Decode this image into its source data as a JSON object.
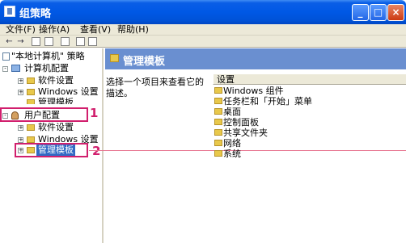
{
  "window": {
    "title": "组策略",
    "buttons": {
      "minimize": "_",
      "maximize": "□",
      "close": "×"
    }
  },
  "menu": [
    "文件(F)",
    "操作(A)",
    "查看(V)",
    "帮助(H)"
  ],
  "tree": {
    "root": "\"本地计算机\" 策略",
    "computer": "计算机配置",
    "c_software": "软件设置",
    "c_windows": "Windows 设置",
    "c_admin": "管理模板",
    "user": "用户配置",
    "u_software": "软件设置",
    "u_windows": "Windows 设置",
    "u_admin": "管理模板"
  },
  "annotations": {
    "one": "1",
    "two": "2"
  },
  "panel": {
    "title": "管理模板",
    "description": "选择一个项目来查看它的描述。",
    "column": "设置",
    "items": [
      "Windows 组件",
      "任务栏和「开始」菜单",
      "桌面",
      "控制面板",
      "共享文件夹",
      "网络",
      "系统"
    ]
  },
  "colors": {
    "titlebar": "#0058e5",
    "selection": "#316ac5",
    "annotation": "#d11f6d",
    "header_band": "#6a8fd0"
  }
}
